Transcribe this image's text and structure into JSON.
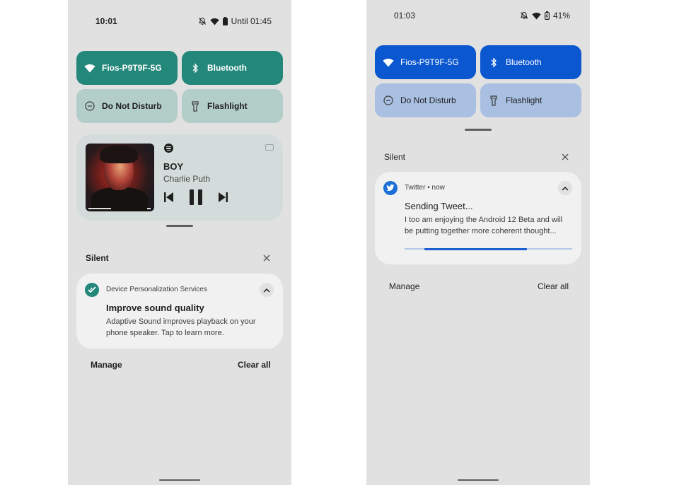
{
  "left_phone": {
    "status": {
      "time": "10:01",
      "battery_text": "Until 01:45",
      "icons": [
        "bell-off-icon",
        "wifi-icon",
        "battery-icon"
      ]
    },
    "tiles": [
      {
        "label": "Fios-P9T9F-5G",
        "icon": "wifi-icon",
        "active": true
      },
      {
        "label": "Bluetooth",
        "icon": "bluetooth-icon",
        "active": true
      },
      {
        "label": "Do Not Disturb",
        "icon": "dnd-icon",
        "active": false
      },
      {
        "label": "Flashlight",
        "icon": "flashlight-icon",
        "active": false
      }
    ],
    "accent": "#23877a",
    "media": {
      "app_icon": "spotify-icon",
      "title": "BOY",
      "artist": "Charlie Puth",
      "controls": [
        "previous",
        "pause",
        "next"
      ]
    },
    "section_label": "Silent",
    "notification": {
      "app_name": "Device Personalization Services",
      "title": "Improve sound quality",
      "body": "Adaptive Sound improves playback on your phone speaker. Tap to learn more."
    },
    "footer": {
      "manage": "Manage",
      "clear_all": "Clear all"
    }
  },
  "right_phone": {
    "status": {
      "time": "01:03",
      "battery_text": "41%",
      "icons": [
        "bell-off-icon",
        "wifi-icon",
        "battery-charging-icon"
      ]
    },
    "tiles": [
      {
        "label": "Fios-P9T9F-5G",
        "icon": "wifi-icon",
        "active": true
      },
      {
        "label": "Bluetooth",
        "icon": "bluetooth-icon",
        "active": true
      },
      {
        "label": "Do Not Disturb",
        "icon": "dnd-icon",
        "active": false
      },
      {
        "label": "Flashlight",
        "icon": "flashlight-icon",
        "active": false
      }
    ],
    "accent": "#0a57d0",
    "section_label": "Silent",
    "notification": {
      "app_name": "Twitter • now",
      "title": "Sending Tweet...",
      "body": "I too am enjoying the Android 12 Beta and will be putting together more coherent thought...",
      "progress": {
        "start": 0.12,
        "end": 0.73
      }
    },
    "footer": {
      "manage": "Manage",
      "clear_all": "Clear all"
    }
  }
}
